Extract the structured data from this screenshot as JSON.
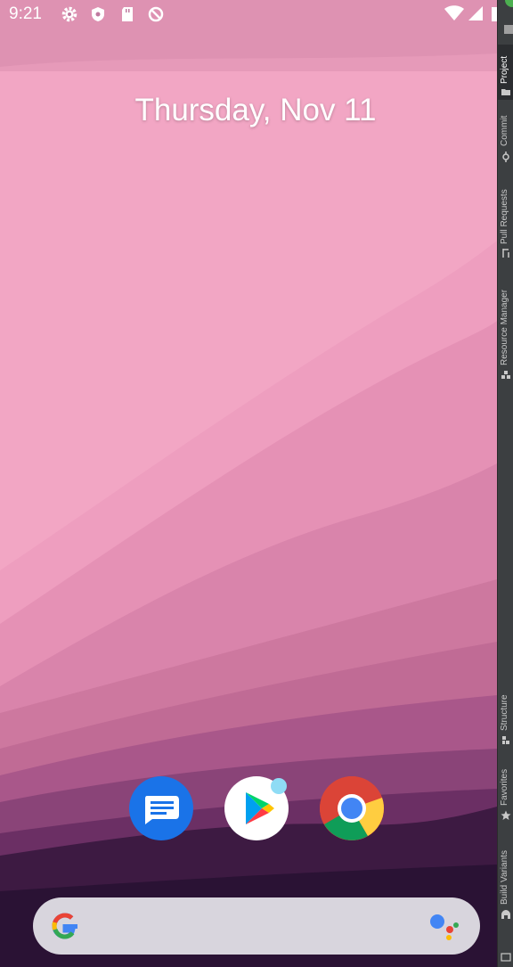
{
  "status_bar": {
    "time": "9:21",
    "icons": [
      "settings-icon",
      "shield-icon",
      "sd-card-icon",
      "no-sync-icon",
      "wifi-icon",
      "signal-icon",
      "battery-icon"
    ]
  },
  "home": {
    "date": "Thursday, Nov 11"
  },
  "dock": {
    "apps": [
      "messages-icon",
      "play-store-icon",
      "chrome-icon"
    ]
  },
  "search_bar": {
    "logo": "google-logo-icon",
    "assistant": "assistant-icon"
  },
  "ide_side_panel": {
    "tools": [
      "Project",
      "Commit",
      "Pull Requests",
      "Resource Manager",
      "Structure",
      "Favorites",
      "Build Variants"
    ],
    "active_tool": "Project"
  },
  "colors": {
    "sky": "#f0a5c4",
    "dock_search_bg": "#d8d5dd",
    "panel_bg": "#3c3f41",
    "messages_blue": "#1a73e8",
    "play_notification_dot": "#8fdcf5"
  }
}
